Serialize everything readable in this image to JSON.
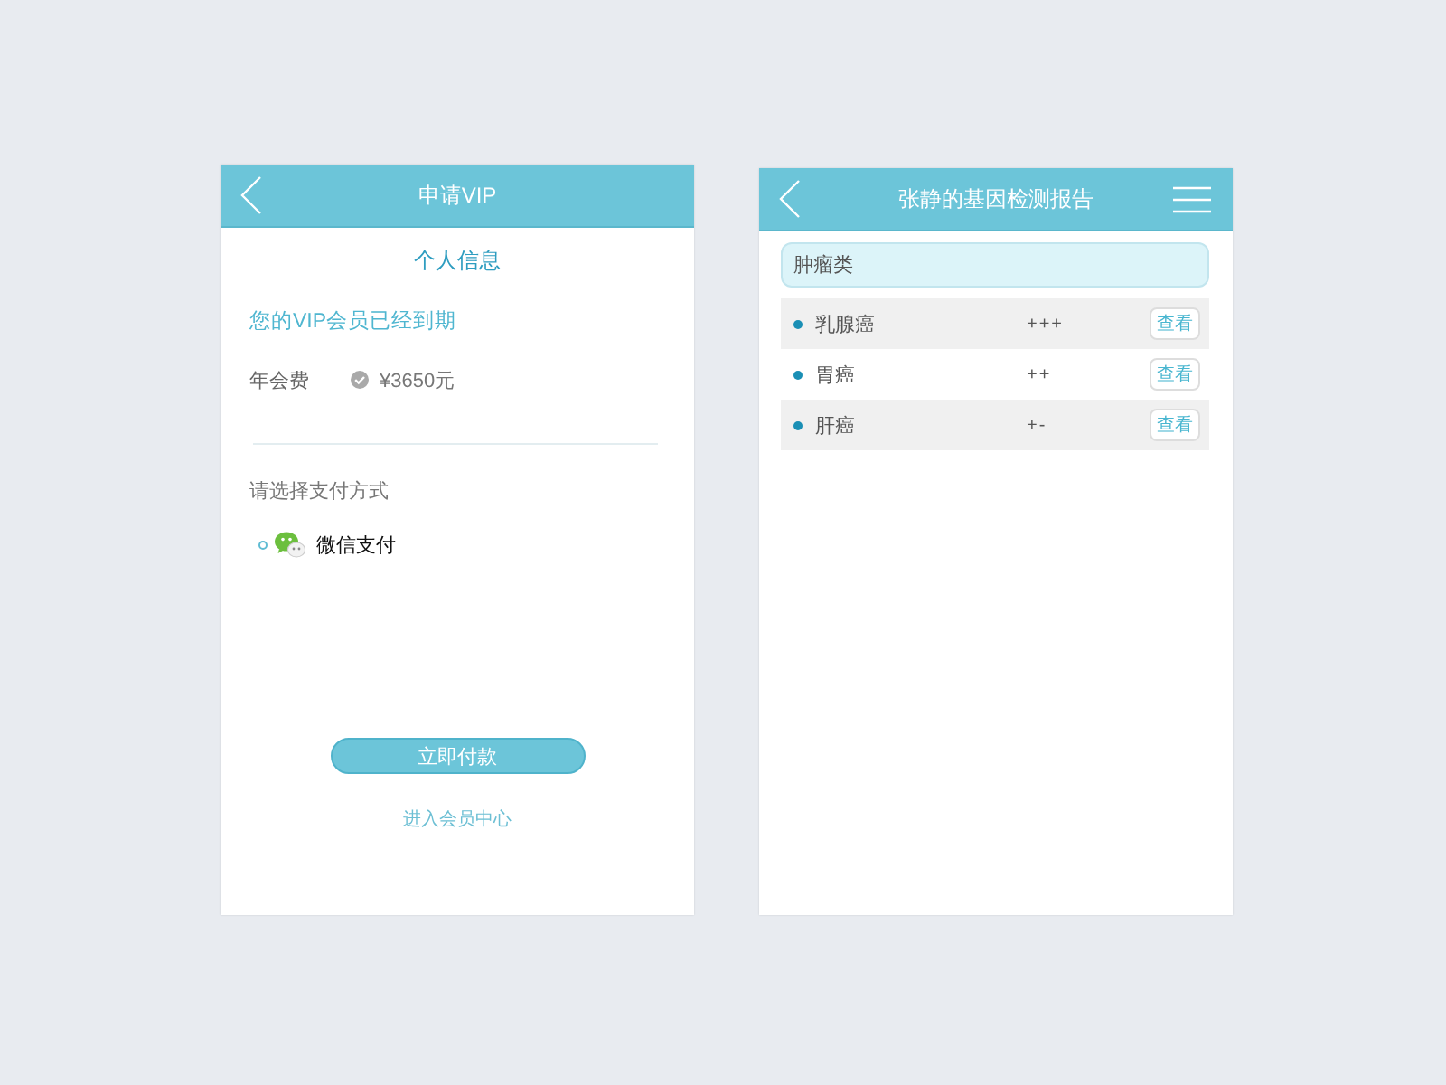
{
  "vip_screen": {
    "header": {
      "title": "申请VIP"
    },
    "section_title": "个人信息",
    "notice": "您的VIP会员已经到期",
    "fee": {
      "label": "年会费",
      "amount": "¥3650元"
    },
    "payment_prompt": "请选择支付方式",
    "payment_methods": [
      {
        "label": "微信支付",
        "selected": false
      }
    ],
    "pay_button": "立即付款",
    "member_center_link": "进入会员中心"
  },
  "report_screen": {
    "header": {
      "title": "张静的基因检测报告"
    },
    "category": "肿瘤类",
    "rows": [
      {
        "name": "乳腺癌",
        "result": "+++",
        "action": "查看"
      },
      {
        "name": "胃癌",
        "result": "++",
        "action": "查看"
      },
      {
        "name": "肝癌",
        "result": "+-",
        "action": "查看"
      }
    ]
  }
}
